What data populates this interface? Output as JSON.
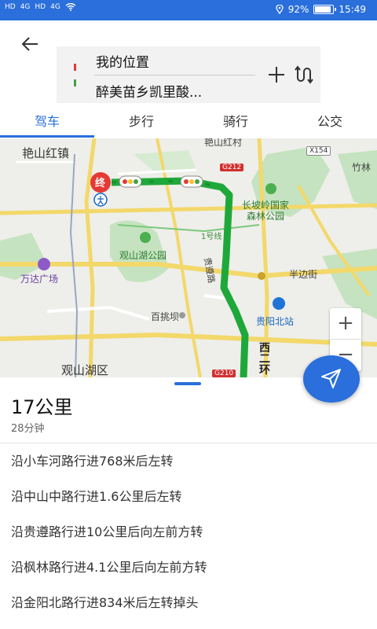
{
  "status_bar": {
    "left_indicators": [
      "HD",
      "4G",
      "HD",
      "4G"
    ],
    "battery_text": "92%",
    "battery_level": 0.92,
    "time": "15:49"
  },
  "header": {
    "back_icon": "arrow-left-icon",
    "from": "我的位置",
    "to": "醉美苗乡凯里酸...",
    "add_icon": "plus-icon",
    "swap_icon": "swap-route-icon"
  },
  "tabs": [
    {
      "label": "驾车",
      "active": true
    },
    {
      "label": "步行",
      "active": false
    },
    {
      "label": "骑行",
      "active": false
    },
    {
      "label": "公交",
      "active": false
    }
  ],
  "map": {
    "labels": {
      "yanshan": "艳山红镇",
      "yanshan_north": "艳山红村",
      "zhulin": "竹林",
      "changpoling": "长坡岭国家",
      "changpoling2": "森林公园",
      "guanshanhu_park": "观山湖公园",
      "wanda": "万达广场",
      "banbian": "半边街",
      "baitiao": "百挑坝",
      "guiyang_north": "贵阳北站",
      "xierhuan_1": "西",
      "xierhuan_2": "二",
      "xierhuan_3": "环",
      "guanshanhu_district": "观山湖区",
      "guizun_road": "贵遵路",
      "line1": "1号线",
      "end_marker": "终"
    },
    "road_badges": {
      "g212": "G212",
      "x154": "X154",
      "g210": "G210"
    },
    "zoom_in": "+",
    "zoom_out": "−"
  },
  "summary": {
    "distance": "17公里",
    "duration": "28分钟"
  },
  "steps": [
    "沿小车河路行进768米后左转",
    "沿中山中路行进1.6公里后左转",
    "沿贵遵路行进10公里后向左前方转",
    "沿枫林路行进4.1公里后向左前方转",
    "沿金阳北路行进834米后左转掉头"
  ],
  "colors": {
    "accent": "#2a6fdb",
    "route": "#1fa83a",
    "end_marker": "#e53935"
  }
}
